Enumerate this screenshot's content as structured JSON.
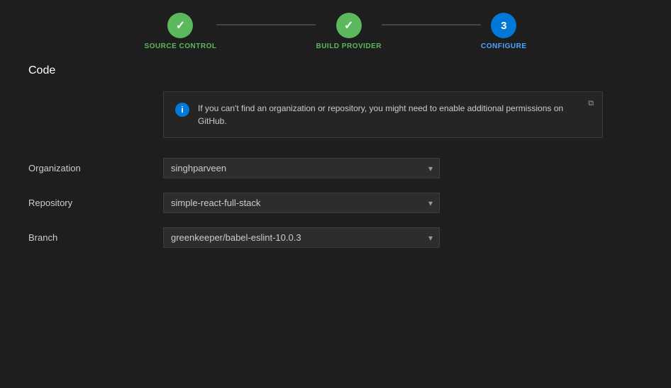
{
  "stepper": {
    "steps": [
      {
        "id": "source-control",
        "number": "✓",
        "label": "SOURCE CONTROL",
        "state": "done"
      },
      {
        "id": "build-provider",
        "number": "✓",
        "label": "BUILD PROVIDER",
        "state": "done"
      },
      {
        "id": "configure",
        "number": "3",
        "label": "CONFIGURE",
        "state": "active"
      }
    ]
  },
  "section": {
    "title": "Code"
  },
  "info": {
    "message": "If you can't find an organization or repository, you might need to enable additional permissions on GitHub."
  },
  "form": {
    "organization": {
      "label": "Organization",
      "value": "singhparveen",
      "options": [
        "singhparveen"
      ]
    },
    "repository": {
      "label": "Repository",
      "value": "simple-react-full-stack",
      "options": [
        "simple-react-full-stack"
      ]
    },
    "branch": {
      "label": "Branch",
      "value": "greenkeeper/babel-eslint-10.0.3",
      "options": [
        "greenkeeper/babel-eslint-10.0.3"
      ]
    }
  },
  "icons": {
    "info": "i",
    "checkmark": "✓",
    "external_link": "⧉",
    "dropdown_arrow": "▾"
  },
  "colors": {
    "done": "#5cb85c",
    "active": "#0078d7",
    "bg": "#1e1e1e",
    "surface": "#2d2d30",
    "border": "#3c3c3c",
    "text": "#cccccc"
  }
}
